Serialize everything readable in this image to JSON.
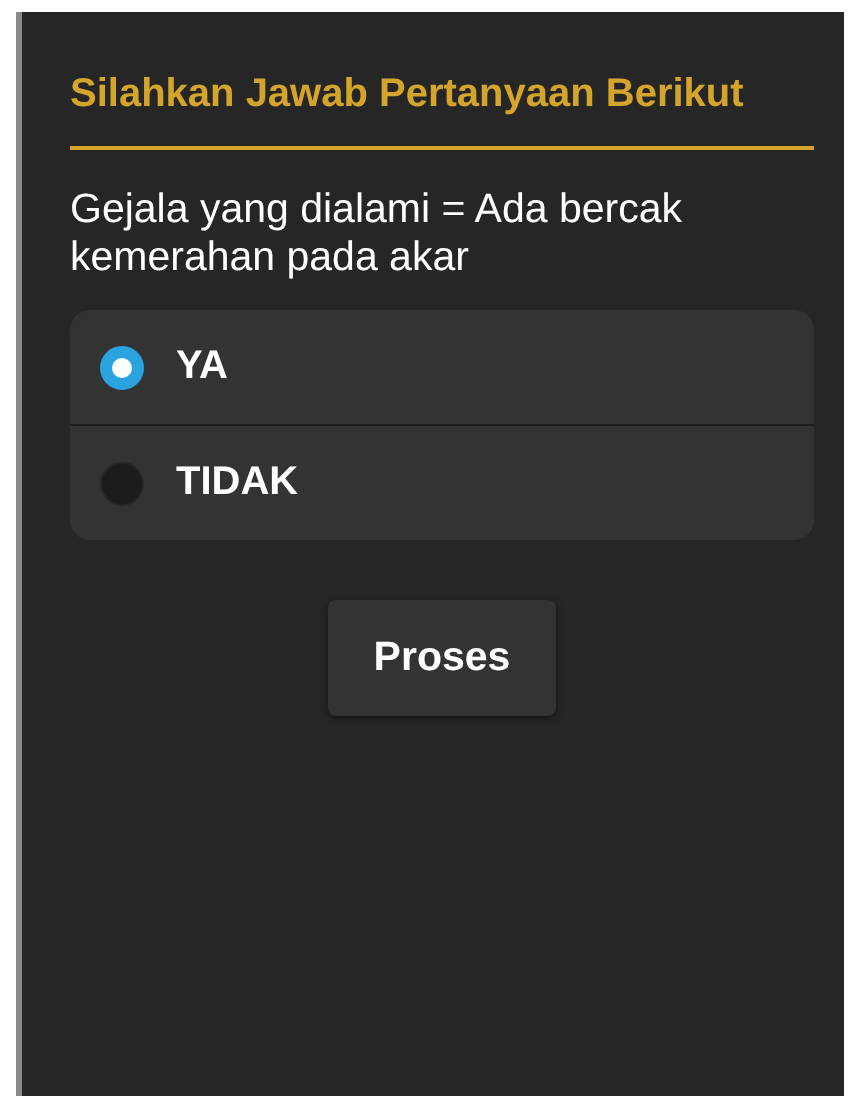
{
  "title": "Silahkan Jawab Pertanyaan Berikut",
  "question": "Gejala yang dialami = Ada bercak kemerahan pada akar",
  "options": [
    {
      "label": "YA",
      "selected": true
    },
    {
      "label": "TIDAK",
      "selected": false
    }
  ],
  "submit_button": "Proses"
}
